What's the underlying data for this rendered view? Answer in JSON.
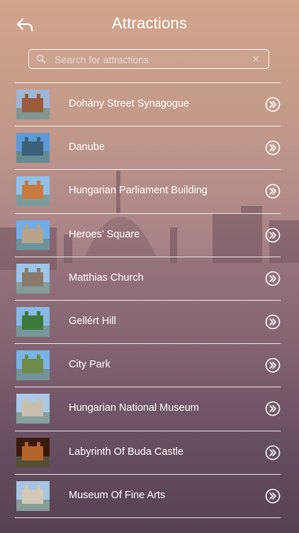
{
  "header": {
    "title": "Attractions",
    "back_icon": "back-arrow-icon"
  },
  "search": {
    "placeholder": "Search for attractions",
    "value": ""
  },
  "items": [
    {
      "label": "Dohány Street Synagogue",
      "thumb_sky": "#9fb6d6",
      "thumb_main": "#9a5b3c"
    },
    {
      "label": "Danube",
      "thumb_sky": "#5c9bd8",
      "thumb_main": "#3c5f7a"
    },
    {
      "label": "Hungarian Parliament Building",
      "thumb_sky": "#8fc0ea",
      "thumb_main": "#c97b3f"
    },
    {
      "label": "Heroes' Square",
      "thumb_sky": "#6faee8",
      "thumb_main": "#b8a48a"
    },
    {
      "label": "Matthias Church",
      "thumb_sky": "#9dc5ea",
      "thumb_main": "#8a7a6a"
    },
    {
      "label": "Gellért Hill",
      "thumb_sky": "#87b9e6",
      "thumb_main": "#3d7a3a"
    },
    {
      "label": "City Park",
      "thumb_sky": "#7ab3e6",
      "thumb_main": "#6f8b4a"
    },
    {
      "label": "Hungarian National Museum",
      "thumb_sky": "#a9c9e6",
      "thumb_main": "#c9bfae"
    },
    {
      "label": "Labyrinth Of Buda Castle",
      "thumb_sky": "#3a1a0c",
      "thumb_main": "#b5652a"
    },
    {
      "label": "Museum Of Fine Arts",
      "thumb_sky": "#a6c6e4",
      "thumb_main": "#d2c9b6"
    }
  ],
  "colors": {
    "text": "#ffffff",
    "separator": "#ffffff"
  }
}
